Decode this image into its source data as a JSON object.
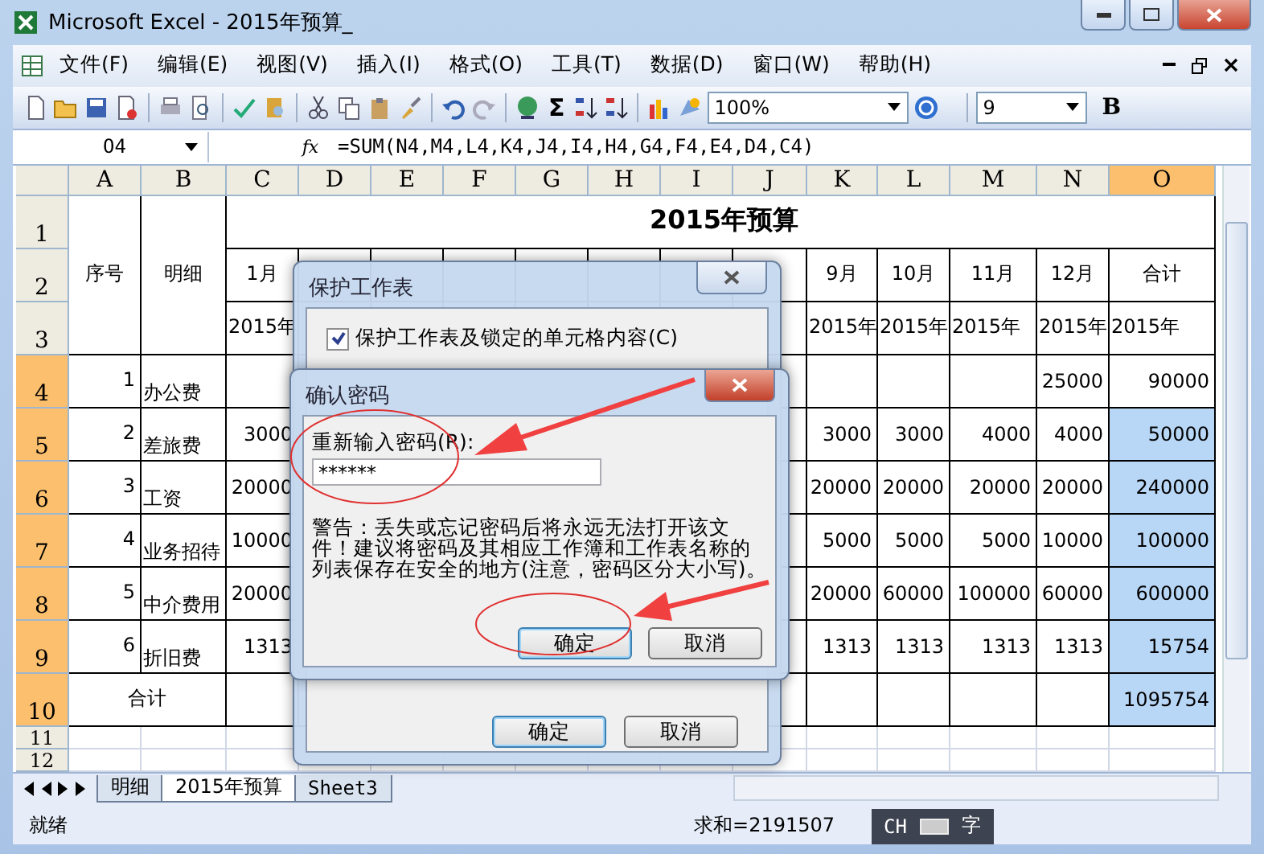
{
  "window": {
    "title": "Microsoft Excel - 2015年预算_"
  },
  "menu": [
    "文件(F)",
    "编辑(E)",
    "视图(V)",
    "插入(I)",
    "格式(O)",
    "工具(T)",
    "数据(D)",
    "窗口(W)",
    "帮助(H)"
  ],
  "toolbar": {
    "zoom": "100%",
    "sum": "Σ",
    "font_size": "9",
    "bold": "B"
  },
  "formula_bar": {
    "name_box": "O4",
    "fx": "fx",
    "formula": "=SUM(N4,M4,L4,K4,J4,I4,H4,G4,F4,E4,D4,C4)"
  },
  "sheet": {
    "columns": [
      {
        "label": "A",
        "selected": false
      },
      {
        "label": "B",
        "selected": false
      },
      {
        "label": "C",
        "selected": false
      },
      {
        "label": "D",
        "selected": false
      },
      {
        "label": "E",
        "selected": false
      },
      {
        "label": "F",
        "selected": false
      },
      {
        "label": "G",
        "selected": false
      },
      {
        "label": "H",
        "selected": false
      },
      {
        "label": "I",
        "selected": false
      },
      {
        "label": "J",
        "selected": false
      },
      {
        "label": "K",
        "selected": false
      },
      {
        "label": "L",
        "selected": false
      },
      {
        "label": "M",
        "selected": false
      },
      {
        "label": "N",
        "selected": false
      },
      {
        "label": "O",
        "selected": true
      }
    ],
    "row_headers": [
      {
        "label": "1",
        "selected": false
      },
      {
        "label": "2",
        "selected": false
      },
      {
        "label": "3",
        "selected": false
      },
      {
        "label": "4",
        "selected": true
      },
      {
        "label": "5",
        "selected": true
      },
      {
        "label": "6",
        "selected": true
      },
      {
        "label": "7",
        "selected": true
      },
      {
        "label": "8",
        "selected": true
      },
      {
        "label": "9",
        "selected": true
      },
      {
        "label": "10",
        "selected": true
      },
      {
        "label": "11",
        "selected": false
      },
      {
        "label": "12",
        "selected": false
      }
    ],
    "title": "2015年预算",
    "head_no": "序号",
    "head_item": "明细",
    "months": [
      {
        "month": "1月",
        "year": "2015年"
      },
      {
        "month": "9月",
        "year": "2015年"
      },
      {
        "month": "10月",
        "year": "2015年"
      },
      {
        "month": "11月",
        "year": "2015年"
      },
      {
        "month": "12月",
        "year": "2015年"
      },
      {
        "month": "合计",
        "year": "2015年"
      }
    ],
    "rows": [
      {
        "no": "1",
        "item": "办公费",
        "n": "25000",
        "total": "90000",
        "selected": false
      },
      {
        "no": "2",
        "item": "差旅费",
        "c": "3000",
        "k": "3000",
        "l": "3000",
        "m": "4000",
        "n": "4000",
        "total": "50000",
        "selected": true
      },
      {
        "no": "3",
        "item": "工资",
        "c": "20000",
        "k": "20000",
        "l": "20000",
        "m": "20000",
        "n": "20000",
        "total": "240000",
        "selected": true
      },
      {
        "no": "4",
        "item": "业务招待",
        "c": "10000",
        "k": "5000",
        "l": "5000",
        "m": "5000",
        "n": "10000",
        "total": "100000",
        "selected": true
      },
      {
        "no": "5",
        "item": "中介费用",
        "c": "20000",
        "k": "20000",
        "l": "60000",
        "m": "100000",
        "n": "60000",
        "total": "600000",
        "selected": true
      },
      {
        "no": "6",
        "item": "折旧费",
        "c": "1313",
        "k": "1313",
        "l": "1313",
        "m": "1313",
        "n": "1313",
        "total": "15754",
        "selected": true
      }
    ],
    "footer": {
      "label": "合计",
      "total": "1095754",
      "selected": true
    }
  },
  "sheet_tabs": [
    {
      "label": "明细",
      "selected": false
    },
    {
      "label": "2015年预算",
      "selected": true
    },
    {
      "label": "Sheet3",
      "selected": false
    }
  ],
  "status_bar": {
    "status": "就绪",
    "sum": "求和=2191507",
    "ime": "CH",
    "ime_mode": "字"
  },
  "protect_dialog": {
    "title": "保护工作表",
    "protect_option": {
      "label": "保护工作表及锁定的单元格内容(C)",
      "checked": true
    },
    "ok": "确定",
    "cancel": "取消"
  },
  "confirm_dialog": {
    "title": "确认密码",
    "label": "重新输入密码(R):",
    "password": "******",
    "warning": "警告：丢失或忘记密码后将永远无法打开该文件！建议将密码及其相应工作簿和工作表名称的列表保存在安全的地方(注意，密码区分大小写)。",
    "ok": "确定",
    "cancel": "取消"
  }
}
